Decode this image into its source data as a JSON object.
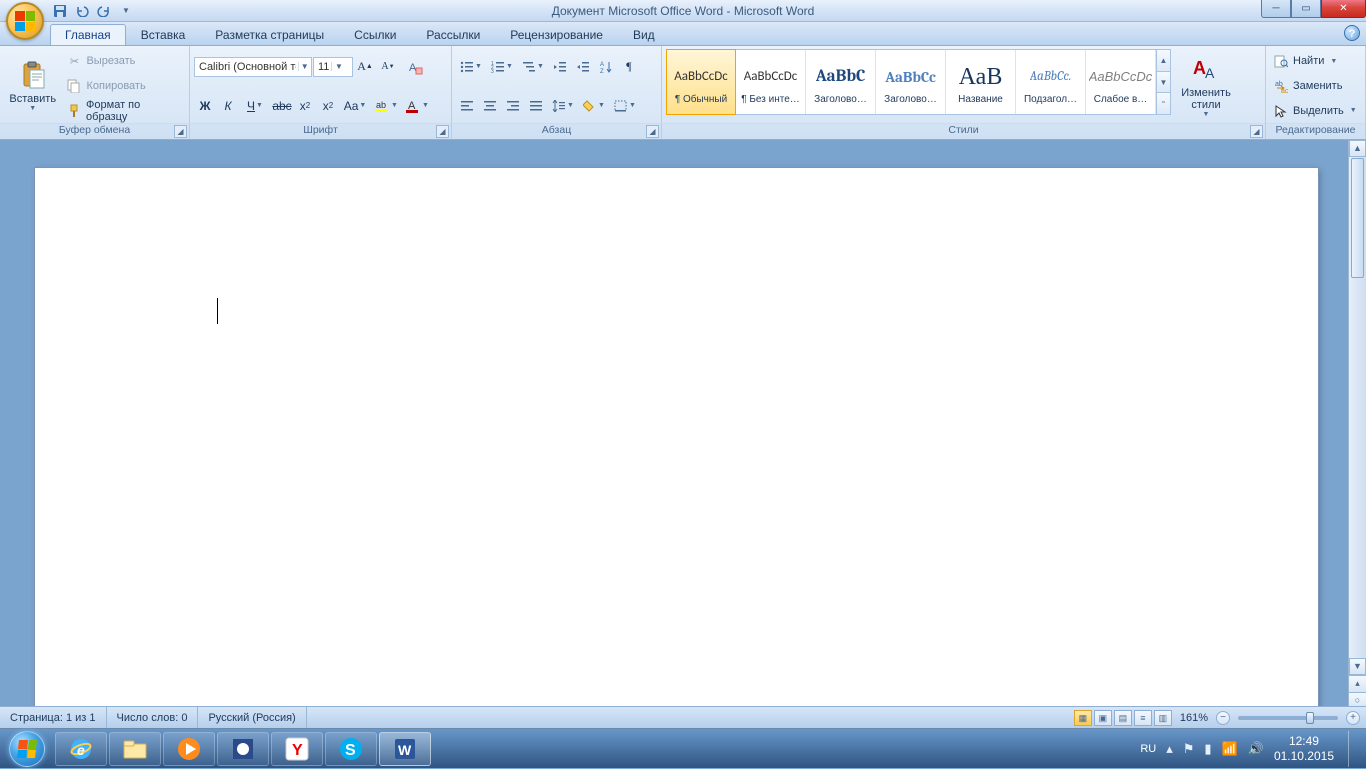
{
  "titlebar": {
    "title": "Документ Microsoft Office Word  -  Microsoft Word"
  },
  "tabs": {
    "items": [
      "Главная",
      "Вставка",
      "Разметка страницы",
      "Ссылки",
      "Рассылки",
      "Рецензирование",
      "Вид"
    ],
    "active": 0
  },
  "clipboard": {
    "paste": "Вставить",
    "cut": "Вырезать",
    "copy": "Копировать",
    "format_painter": "Формат по образцу",
    "group": "Буфер обмена"
  },
  "font": {
    "name": "Calibri (Основной те",
    "size": "11",
    "group": "Шрифт"
  },
  "paragraph": {
    "group": "Абзац"
  },
  "styles": {
    "group": "Стили",
    "change": "Изменить стили",
    "items": [
      {
        "preview": "AaBbCcDc",
        "label": "¶ Обычный",
        "sel": true,
        "css": "font-family:Calibri;"
      },
      {
        "preview": "AaBbCcDc",
        "label": "¶ Без инте…",
        "css": "font-family:Calibri;"
      },
      {
        "preview": "AaBbC",
        "label": "Заголово…",
        "css": "color:#1f497d;font-weight:bold;font-size:17px;font-family:Cambria,serif;"
      },
      {
        "preview": "AaBbCc",
        "label": "Заголово…",
        "css": "color:#4f81bd;font-weight:bold;font-size:15px;font-family:Cambria,serif;"
      },
      {
        "preview": "АаВ",
        "label": "Название",
        "css": "font-size:24px;font-family:Cambria,serif;color:#17365d;"
      },
      {
        "preview": "AaBbCc.",
        "label": "Подзагол…",
        "css": "color:#4f81bd;font-style:italic;font-family:Cambria,serif;"
      },
      {
        "preview": "AaBbCcDc",
        "label": "Слабое в…",
        "css": "color:#808080;font-style:italic;"
      }
    ]
  },
  "editing": {
    "find": "Найти",
    "replace": "Заменить",
    "select": "Выделить",
    "group": "Редактирование"
  },
  "status": {
    "page": "Страница: 1 из 1",
    "words": "Число слов: 0",
    "lang": "Русский (Россия)",
    "zoom": "161%"
  },
  "taskbar": {
    "lang": "RU",
    "time": "12:49",
    "date": "01.10.2015"
  }
}
